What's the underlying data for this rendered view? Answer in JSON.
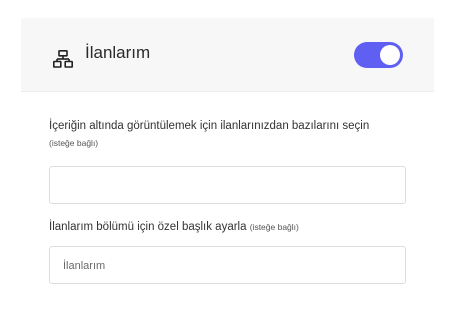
{
  "header": {
    "icon": "sitemap-icon",
    "title": "İlanlarım",
    "toggle_on": true,
    "toggle_color": "#5f5ff2"
  },
  "fields": [
    {
      "label": "İçeriğin altında görüntülemek için ilanlarınızdan bazılarını seçin",
      "optional": "(isteğe bağlı)",
      "value": "",
      "placeholder": ""
    },
    {
      "label": "İlanlarım bölümü için özel başlık ayarla",
      "optional": "(isteğe bağlı)",
      "value": "",
      "placeholder": "İlanlarım"
    }
  ]
}
